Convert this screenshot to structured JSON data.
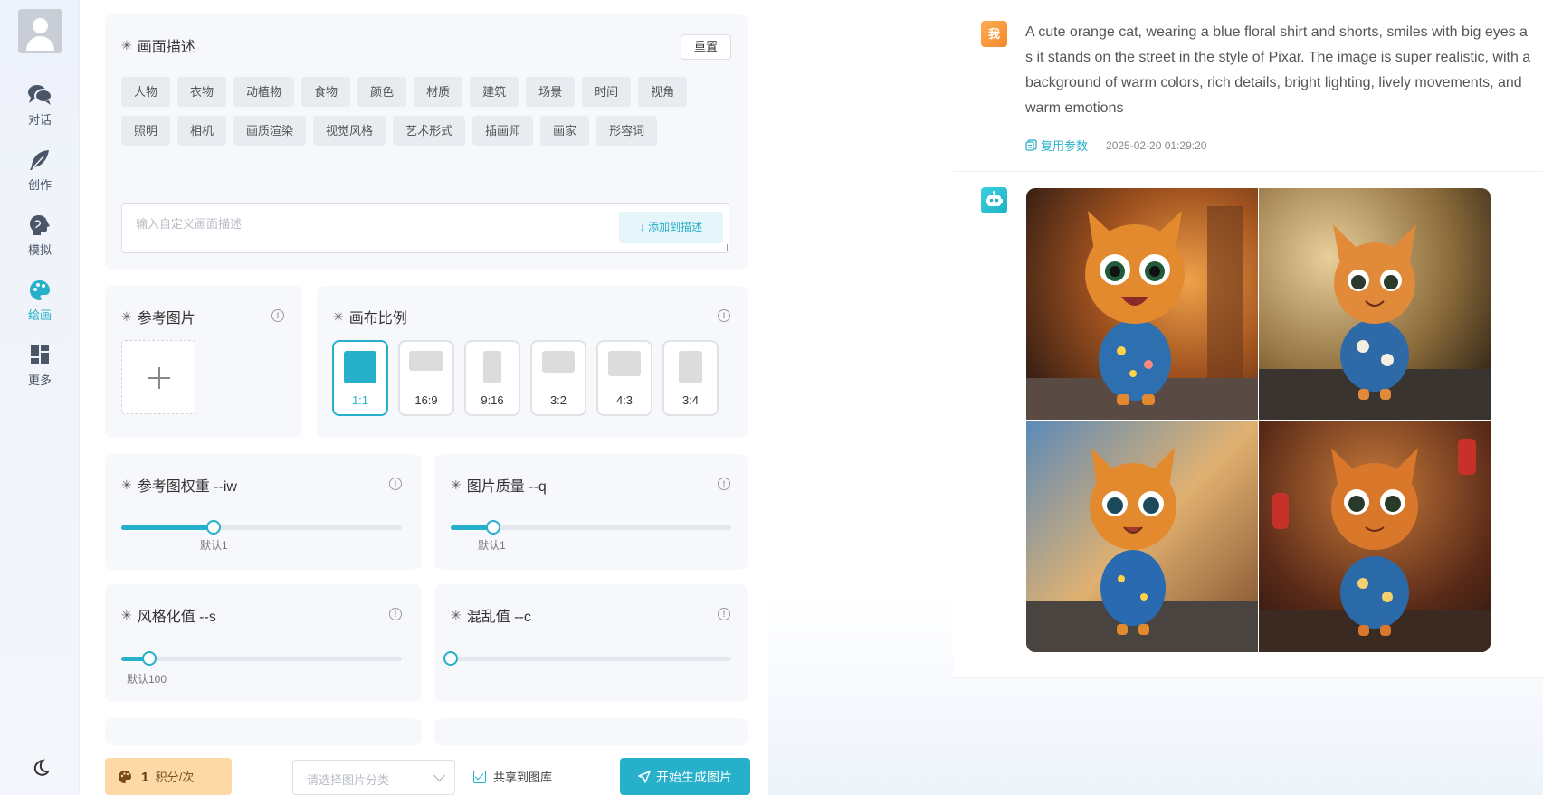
{
  "sidebar": {
    "items": [
      {
        "label": "对话",
        "icon": "chat-icon"
      },
      {
        "label": "创作",
        "icon": "feather-icon"
      },
      {
        "label": "模拟",
        "icon": "head-icon"
      },
      {
        "label": "绘画",
        "icon": "palette-icon",
        "active": true
      },
      {
        "label": "更多",
        "icon": "grid-icon"
      }
    ]
  },
  "description": {
    "title": "画面描述",
    "reset_label": "重置",
    "tags": [
      "人物",
      "衣物",
      "动植物",
      "食物",
      "颜色",
      "材质",
      "建筑",
      "场景",
      "时间",
      "视角",
      "照明",
      "相机",
      "画质渲染",
      "视觉风格",
      "艺术形式",
      "插画师",
      "画家",
      "形容词"
    ],
    "input_placeholder": "输入自定义画面描述",
    "add_label": "添加到描述"
  },
  "reference": {
    "title": "参考图片"
  },
  "ratio": {
    "title": "画布比例",
    "options": [
      "1:1",
      "16:9",
      "9:16",
      "3:2",
      "4:3",
      "3:4"
    ],
    "selected": "1:1"
  },
  "sliders": {
    "iw": {
      "title": "参考图权重 --iw",
      "caption": "默认1",
      "value_fraction": 0.33
    },
    "q": {
      "title": "图片质量 --q",
      "caption": "默认1",
      "value_fraction": 0.15
    },
    "s": {
      "title": "风格化值 --s",
      "caption": "默认100",
      "value_fraction": 0.1
    },
    "c": {
      "title": "混乱值 --c",
      "caption": "",
      "value_fraction": 0.0
    }
  },
  "bottom": {
    "cost_number": "1",
    "cost_unit": "积分/次",
    "category_placeholder": "请选择图片分类",
    "share_label": "共享到图库",
    "share_checked": true,
    "generate_label": "开始生成图片"
  },
  "chat": {
    "user_badge": "我",
    "prompt": "A cute orange cat, wearing a blue floral shirt and shorts, smiles with big eyes as it stands on the street in the style of Pixar. The image is super realistic, with a background of warm colors, rich details, bright lighting, lively movements, and warm emotions",
    "reuse_label": "复用参数",
    "timestamp": "2025-02-20 01:29:20"
  },
  "colors": {
    "accent": "#26b0c9",
    "cost_bg": "#fcd9a6",
    "user_badge": "#f3872a"
  }
}
